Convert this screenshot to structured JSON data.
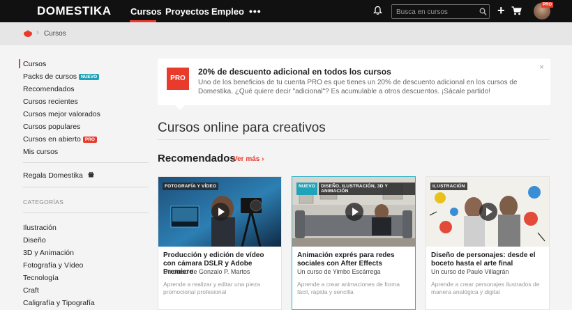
{
  "header": {
    "logo": "DOMESTIKA",
    "nav": [
      {
        "label": "Cursos",
        "active": true
      },
      {
        "label": "Proyectos"
      },
      {
        "label": "Empleo"
      }
    ],
    "more": "•••",
    "search_placeholder": "Busca en cursos",
    "plus": "+",
    "pro_badge": "PRO"
  },
  "breadcrumb": {
    "current": "Cursos"
  },
  "sidebar": {
    "items": [
      {
        "label": "Cursos",
        "active": true
      },
      {
        "label": "Packs de cursos",
        "badge": "NUEVO"
      },
      {
        "label": "Recomendados"
      },
      {
        "label": "Cursos recientes"
      },
      {
        "label": "Cursos mejor valorados"
      },
      {
        "label": "Cursos populares"
      },
      {
        "label": "Cursos en abierto",
        "badge": "PRO"
      },
      {
        "label": "Mis cursos"
      }
    ],
    "gift": "Regala Domestika",
    "categories_title": "CATEGORÍAS",
    "categories": [
      "Ilustración",
      "Diseño",
      "3D y Animación",
      "Fotografía y Vídeo",
      "Tecnología",
      "Craft",
      "Caligrafía y Tipografía"
    ]
  },
  "promo": {
    "badge": "PRO",
    "title": "20% de descuento adicional en todos los cursos",
    "text": "Uno de los beneficios de tu cuenta PRO es que tienes un 20% de descuento adicional en los cursos de Domestika. ¿Qué quiere decir \"adicional\"? Es acumulable a otros descuentos. ¡Sácale partido!",
    "close": "×"
  },
  "main": {
    "title": "Cursos online para creativos",
    "section_title": "Recomendados",
    "see_more": "Ver más ›"
  },
  "cards": [
    {
      "tags": [
        "FOTOGRAFÍA Y VÍDEO"
      ],
      "title": "Producción y edición de vídeo con cámara DSLR y Adobe Premiere",
      "author": "Un curso de Gonzalo P. Martos",
      "desc": "Aprende a realizar y editar una pieza promocional profesional"
    },
    {
      "tags": [
        "NUEVO",
        "DISEÑO, ILUSTRACIÓN, 3D Y ANIMACIÓN"
      ],
      "title": "Animación exprés para redes sociales con After Effects",
      "author": "Un curso de Yimbo Escárrega",
      "desc": "Aprende a crear animaciones de forma fácil, rápida y sencilla"
    },
    {
      "tags": [
        "ILUSTRACIÓN"
      ],
      "title": "Diseño de personajes: desde el boceto hasta el arte final",
      "author": "Un curso de Paulo Villagrán",
      "desc": "Aprende a crear personajes ilustrados de manera analógica y digital"
    }
  ],
  "colors": {
    "accent": "#e93b2c",
    "teal": "#1fa3b8",
    "topbar": "#111111"
  }
}
